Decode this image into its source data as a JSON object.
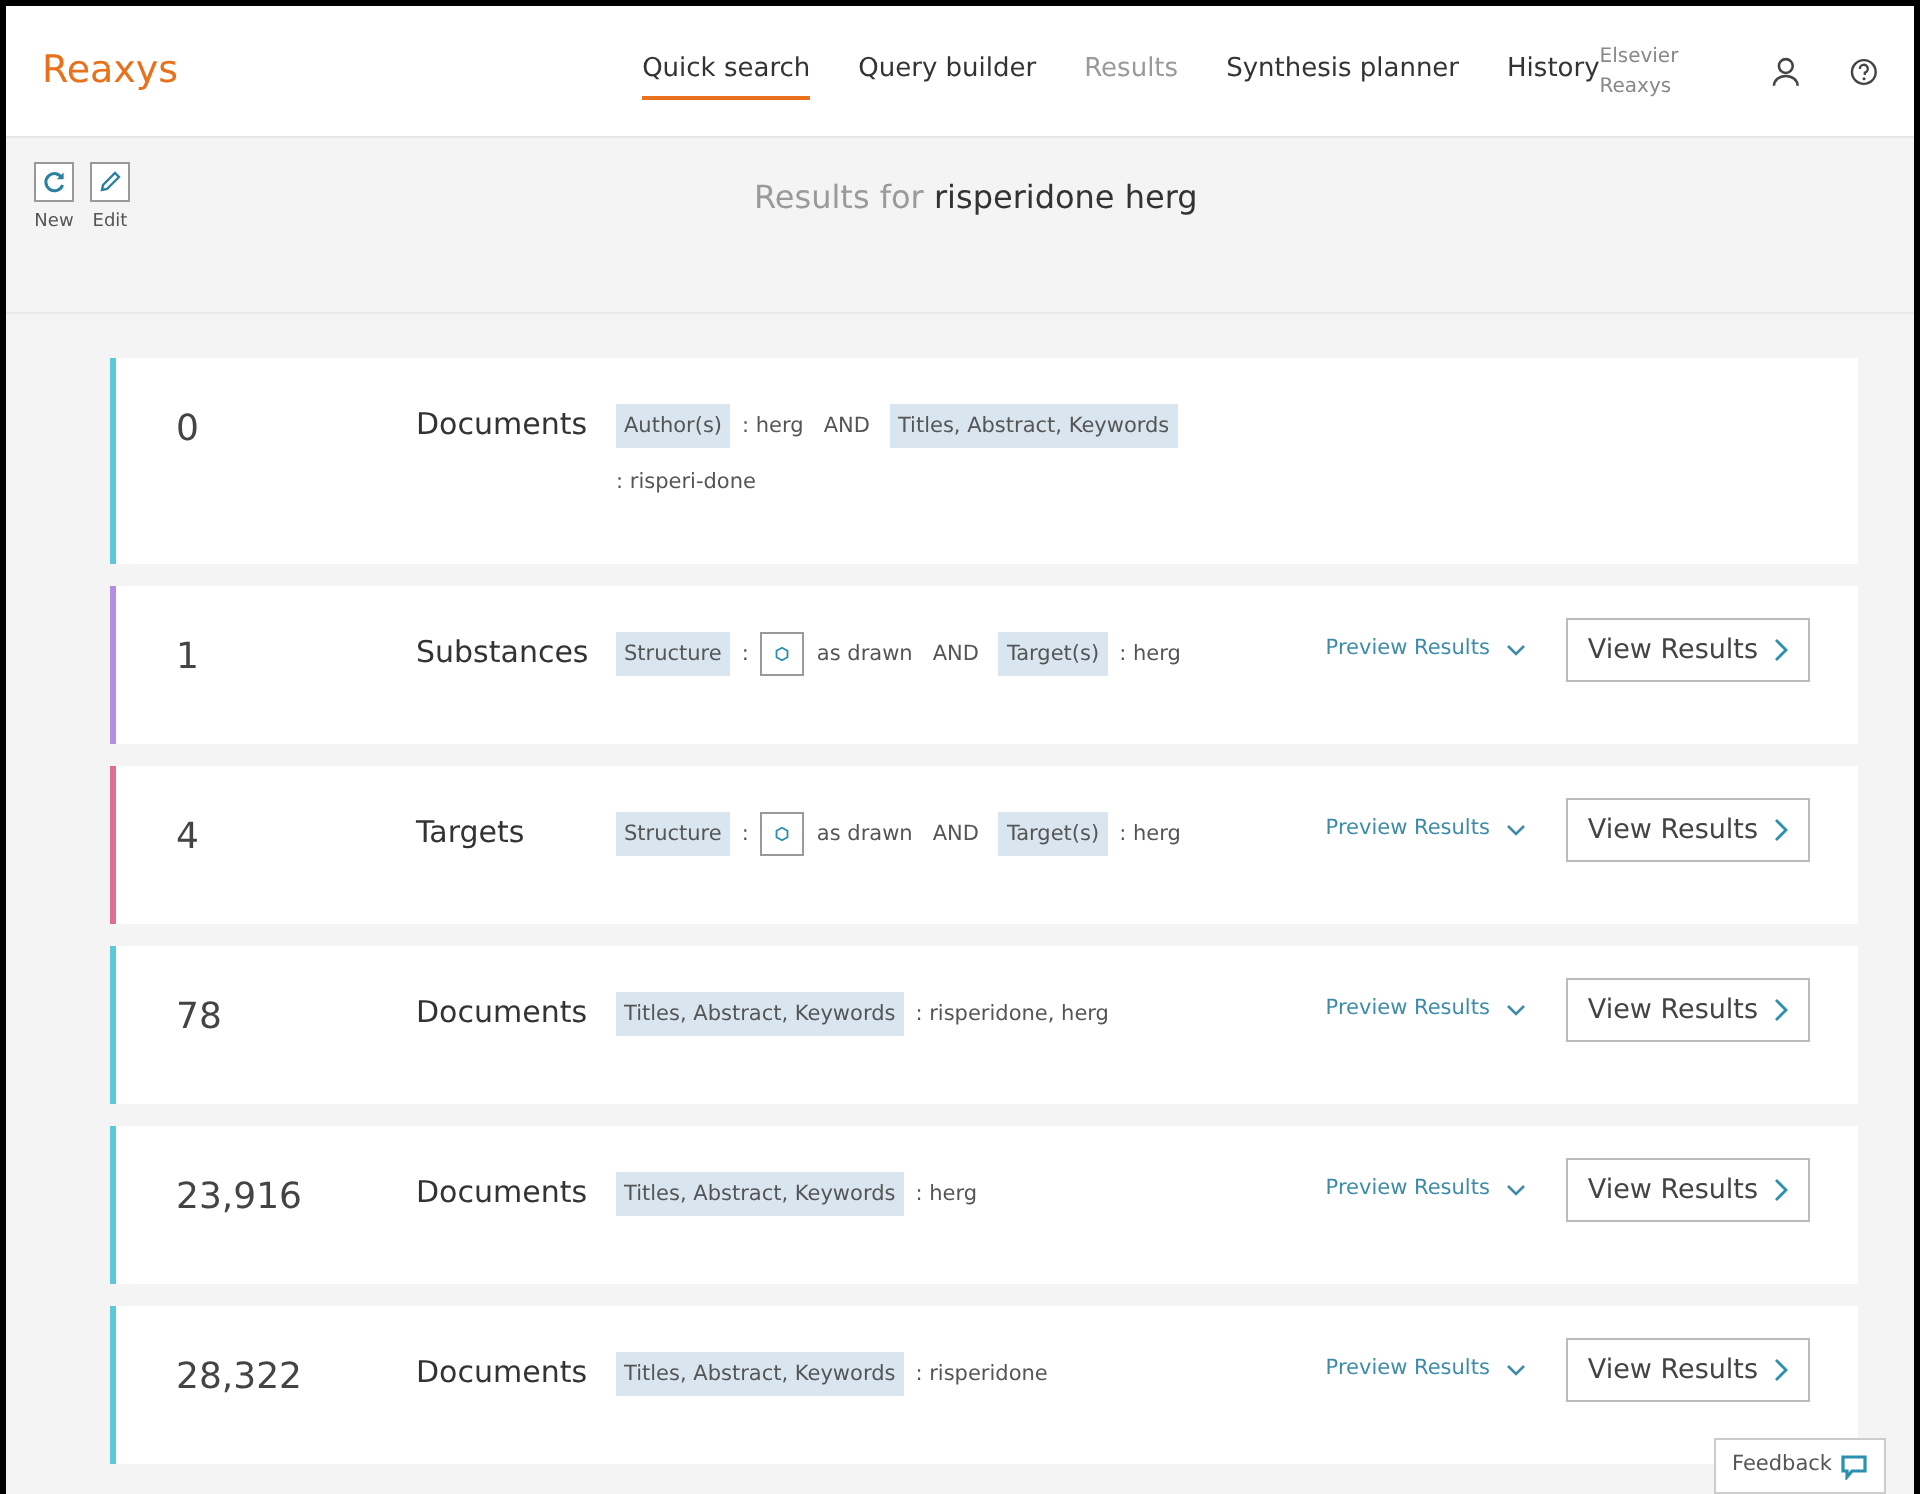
{
  "header": {
    "logo": "Reaxys",
    "tabs": [
      {
        "label": "Quick search",
        "selected": true,
        "disabled": false
      },
      {
        "label": "Query builder",
        "selected": false,
        "disabled": false
      },
      {
        "label": "Results",
        "selected": false,
        "disabled": true
      },
      {
        "label": "Synthesis planner",
        "selected": false,
        "disabled": false
      },
      {
        "label": "History",
        "selected": false,
        "disabled": false
      }
    ],
    "account": "Elsevier Reaxys"
  },
  "toolbar": {
    "buttons": [
      {
        "label": "New",
        "kind": "refresh"
      },
      {
        "label": "Edit",
        "kind": "edit"
      }
    ],
    "title_prefix": "Results for",
    "title_query": "risperidone herg"
  },
  "results": [
    {
      "count": "0",
      "category": "Documents",
      "color": "#5cc8da",
      "query": [
        {
          "kind": "field",
          "text": "Author(s)"
        },
        {
          "kind": "text",
          "text": ": herg"
        },
        {
          "kind": "op",
          "text": "AND"
        },
        {
          "kind": "field",
          "text": "Titles, Abstract, Keywords"
        },
        {
          "kind": "text",
          "text": ": risperi-done"
        }
      ]
    },
    {
      "count": "1",
      "category": "Substances",
      "color": "#b48ee2",
      "query": [
        {
          "kind": "field",
          "text": "Structure"
        },
        {
          "kind": "text",
          "text": ":"
        },
        {
          "kind": "structure"
        },
        {
          "kind": "text",
          "text": "as drawn"
        },
        {
          "kind": "op",
          "text": "AND"
        },
        {
          "kind": "field",
          "text": "Target(s)"
        },
        {
          "kind": "text",
          "text": ": herg"
        }
      ],
      "preview": "Preview Results",
      "view": "View Results"
    },
    {
      "count": "4",
      "category": "Targets",
      "color": "#e06e8e",
      "query": [
        {
          "kind": "field",
          "text": "Structure"
        },
        {
          "kind": "text",
          "text": ":"
        },
        {
          "kind": "structure"
        },
        {
          "kind": "text",
          "text": "as drawn"
        },
        {
          "kind": "op",
          "text": "AND"
        },
        {
          "kind": "field",
          "text": "Target(s)"
        },
        {
          "kind": "text",
          "text": ": herg"
        }
      ],
      "preview": "Preview Results",
      "view": "View Results"
    },
    {
      "count": "78",
      "category": "Documents",
      "color": "#5cc8da",
      "query": [
        {
          "kind": "field",
          "text": "Titles, Abstract, Keywords"
        },
        {
          "kind": "text",
          "text": ": risperidone, herg"
        }
      ],
      "preview": "Preview Results",
      "view": "View Results"
    },
    {
      "count": "23,916",
      "category": "Documents",
      "color": "#5cc8da",
      "query": [
        {
          "kind": "field",
          "text": "Titles, Abstract, Keywords"
        },
        {
          "kind": "text",
          "text": ": herg"
        }
      ],
      "preview": "Preview Results",
      "view": "View Results"
    },
    {
      "count": "28,322",
      "category": "Documents",
      "color": "#5cc8da",
      "query": [
        {
          "kind": "field",
          "text": "Titles, Abstract, Keywords"
        },
        {
          "kind": "text",
          "text": ": risperidone"
        }
      ],
      "preview": "Preview Results",
      "view": "View Results"
    }
  ],
  "feedback": "Feedback"
}
